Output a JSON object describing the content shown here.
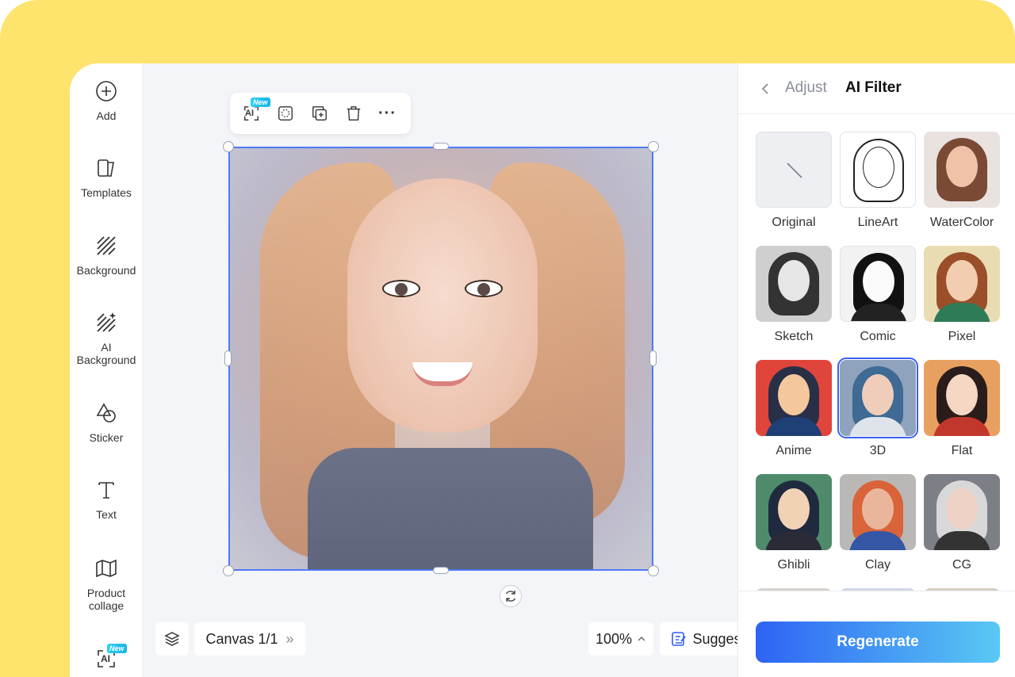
{
  "sidebar": {
    "items": [
      {
        "label": "Add"
      },
      {
        "label": "Templates"
      },
      {
        "label": "Background"
      },
      {
        "label": "AI Background"
      },
      {
        "label": "Sticker"
      },
      {
        "label": "Text"
      },
      {
        "label": "Product collage"
      }
    ],
    "ai_tool": {
      "icon_text": "AI",
      "badge": "New"
    }
  },
  "toolbar": {
    "ai_icon_text": "AI",
    "ai_badge": "New",
    "more": "···"
  },
  "canvas": {
    "layers_icon": "layers-icon",
    "page_label": "Canvas 1/1",
    "page_chevron": "»",
    "zoom": "100%",
    "suggest": "Suggest",
    "help": "?"
  },
  "panel": {
    "tabs": {
      "adjust": "Adjust",
      "ai_filter": "AI Filter"
    },
    "filters": [
      {
        "label": "Original",
        "style": "original"
      },
      {
        "label": "LineArt",
        "style": "lineart"
      },
      {
        "label": "WaterColor",
        "style": "watercolor"
      },
      {
        "label": "Sketch",
        "style": "sketch"
      },
      {
        "label": "Comic",
        "style": "comic"
      },
      {
        "label": "Pixel",
        "style": "pixel"
      },
      {
        "label": "Anime",
        "style": "anime"
      },
      {
        "label": "3D",
        "style": "3d",
        "selected": true
      },
      {
        "label": "Flat",
        "style": "flat"
      },
      {
        "label": "Ghibli",
        "style": "ghibli"
      },
      {
        "label": "Clay",
        "style": "clay"
      },
      {
        "label": "CG",
        "style": "cg"
      }
    ],
    "regenerate": "Regenerate"
  },
  "colors": {
    "frame": "#FEE36C",
    "accent": "#4F7AF7",
    "button_gradient_start": "#2E63F4",
    "button_gradient_end": "#59C9F4"
  }
}
